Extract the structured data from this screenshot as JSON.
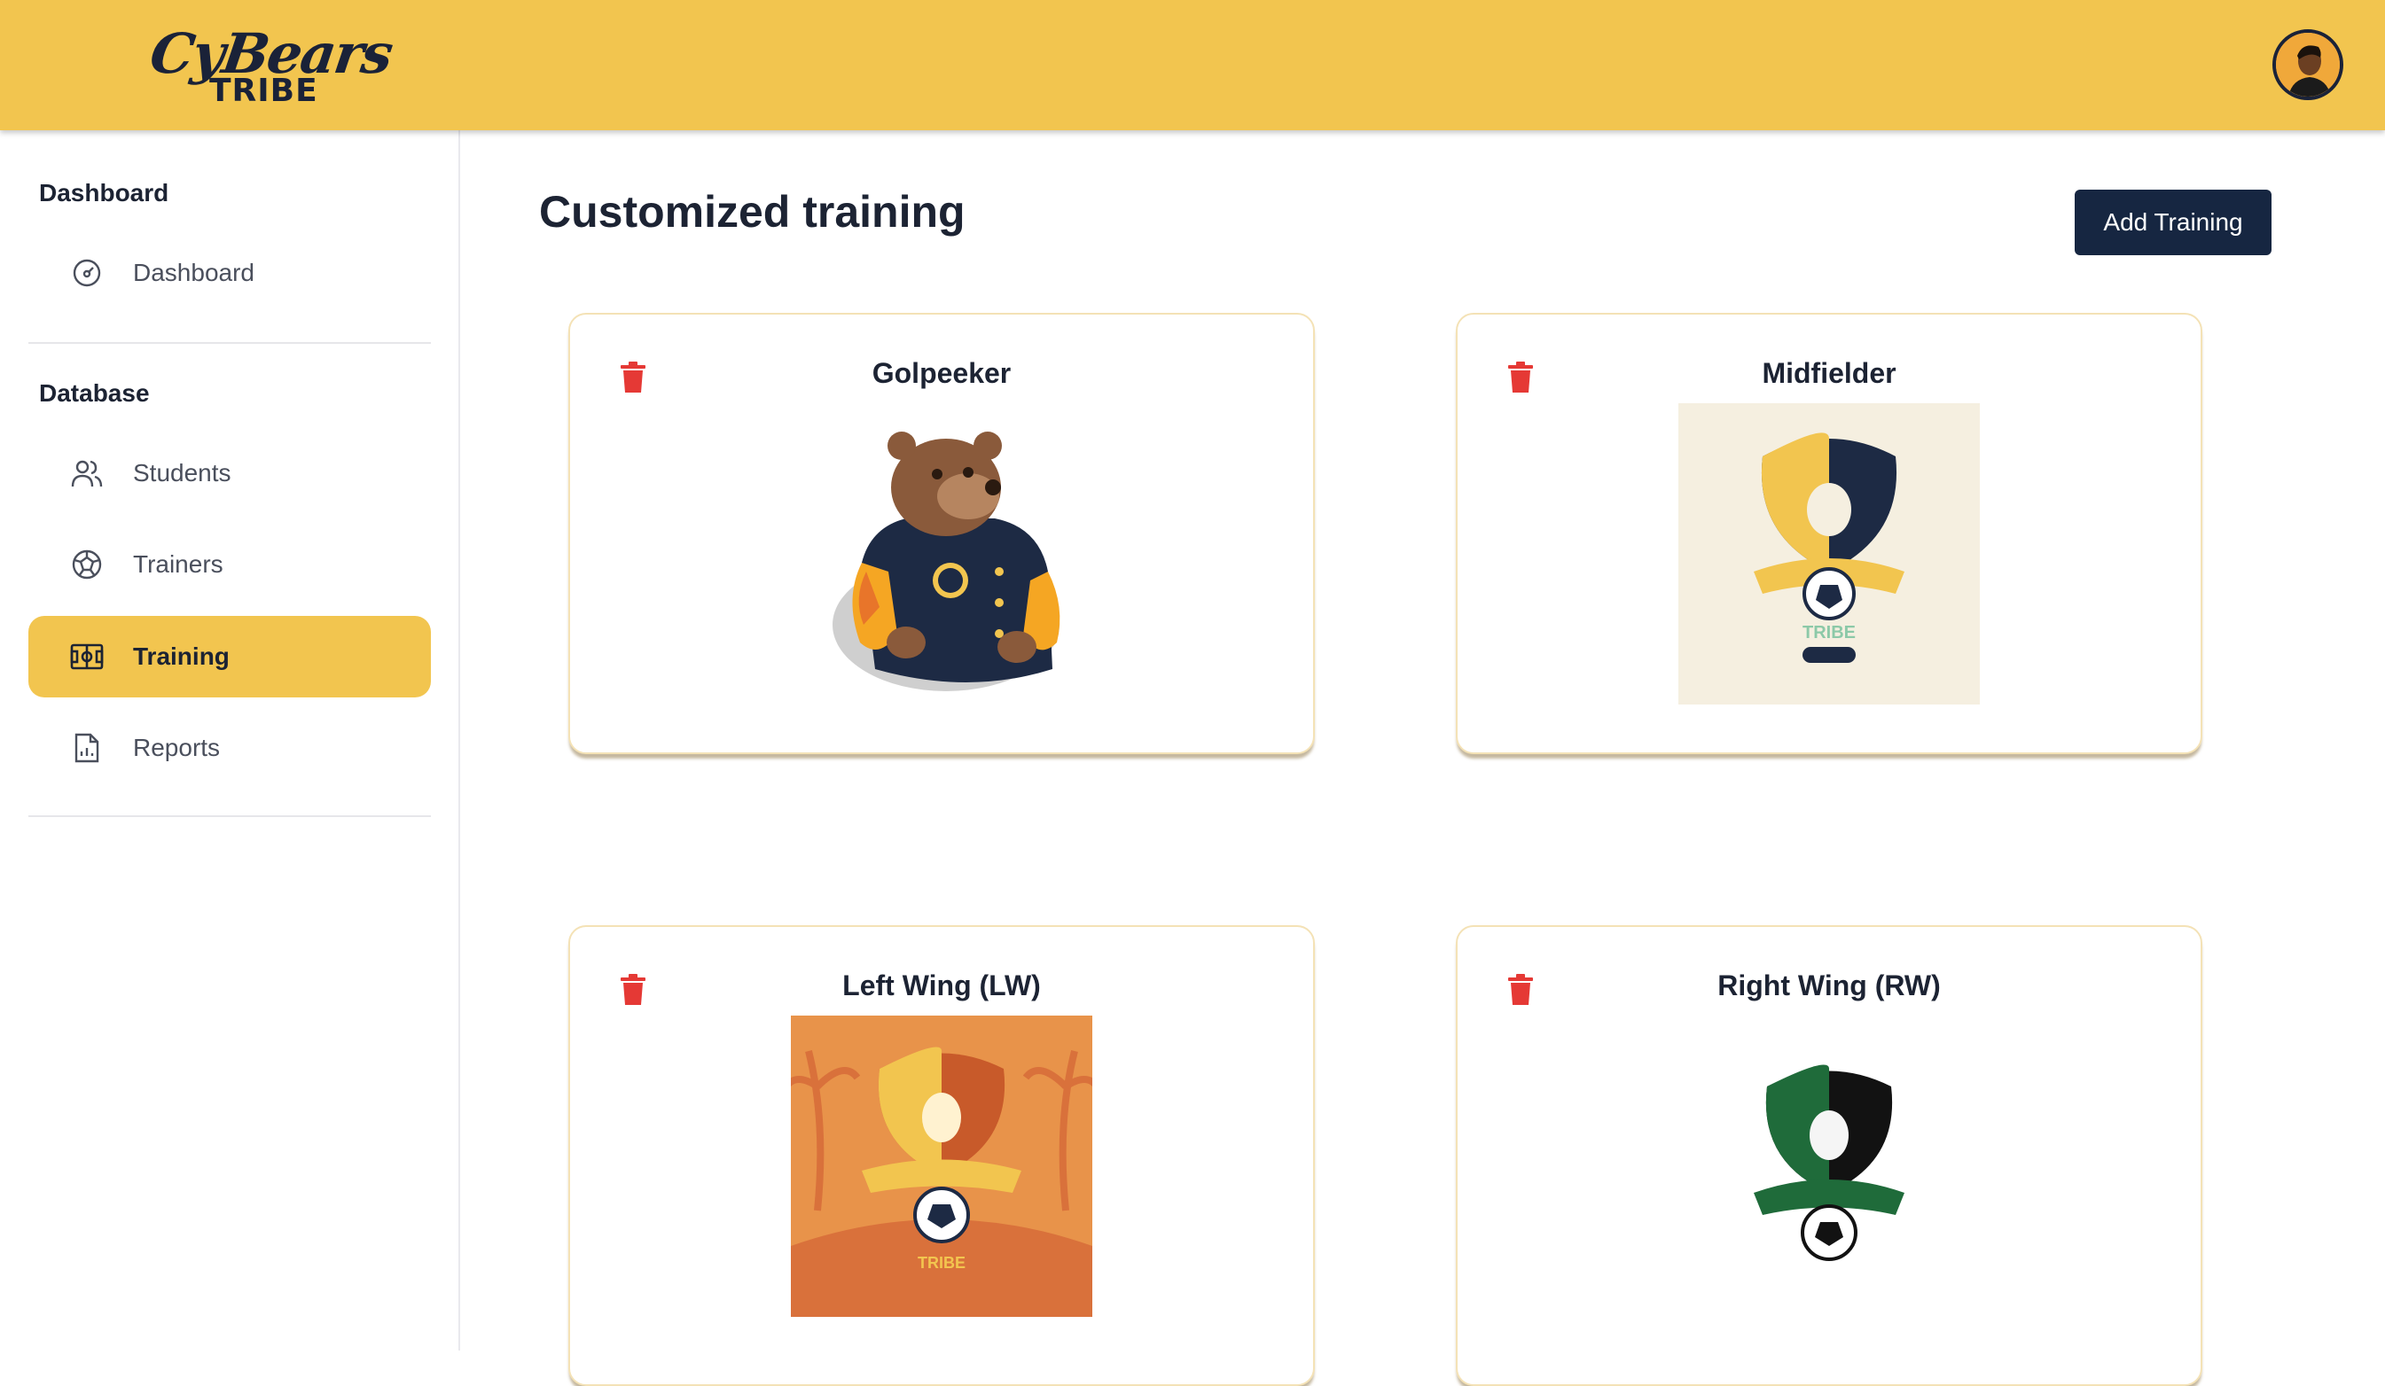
{
  "header": {
    "logo_script": "CyBears",
    "logo_sub": "TRIBE",
    "avatar_icon": "user-avatar"
  },
  "sidebar": {
    "sections": [
      {
        "title": "Dashboard",
        "items": [
          {
            "label": "Dashboard",
            "icon": "gauge-icon",
            "active": false
          }
        ]
      },
      {
        "title": "Database",
        "items": [
          {
            "label": "Students",
            "icon": "users-icon",
            "active": false
          },
          {
            "label": "Trainers",
            "icon": "soccer-ball-icon",
            "active": false
          },
          {
            "label": "Training",
            "icon": "field-icon",
            "active": true
          },
          {
            "label": "Reports",
            "icon": "report-icon",
            "active": false
          }
        ]
      }
    ]
  },
  "main": {
    "title": "Customized training",
    "add_button": "Add Training",
    "cards": [
      {
        "title": "Golpeeker",
        "image": "bear-mascot-jacket",
        "delete_icon": "trash-icon"
      },
      {
        "title": "Midfielder",
        "image": "cybears-logo-cream",
        "delete_icon": "trash-icon"
      },
      {
        "title": "Left Wing (LW)",
        "image": "cybears-logo-orange-palms",
        "delete_icon": "trash-icon"
      },
      {
        "title": "Right Wing (RW)",
        "image": "cybears-logo-green",
        "delete_icon": "trash-icon"
      }
    ]
  },
  "colors": {
    "accent_yellow": "#f2c54f",
    "navy": "#162641",
    "delete_red": "#e53935",
    "card_border": "#f4e2b6"
  }
}
